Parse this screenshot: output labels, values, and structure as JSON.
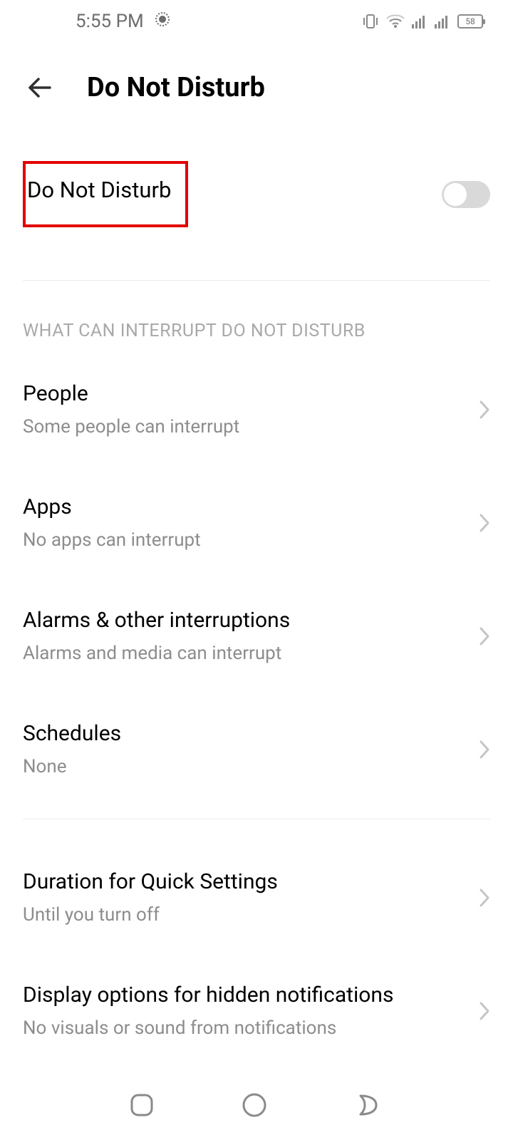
{
  "status_bar": {
    "time": "5:55 PM",
    "battery_percent": "58"
  },
  "header": {
    "title": "Do Not Disturb"
  },
  "toggle": {
    "label": "Do Not Disturb",
    "enabled": false
  },
  "section_header": "WHAT CAN INTERRUPT DO NOT DISTURB",
  "items": [
    {
      "title": "People",
      "subtitle": "Some people can interrupt"
    },
    {
      "title": "Apps",
      "subtitle": "No apps can interrupt"
    },
    {
      "title": "Alarms & other interruptions",
      "subtitle": "Alarms and media can interrupt"
    },
    {
      "title": "Schedules",
      "subtitle": "None"
    }
  ],
  "items2": [
    {
      "title": "Duration for Quick Settings",
      "subtitle": "Until you turn off"
    },
    {
      "title": "Display options for hidden notifications",
      "subtitle": "No visuals or sound from notifications"
    }
  ]
}
